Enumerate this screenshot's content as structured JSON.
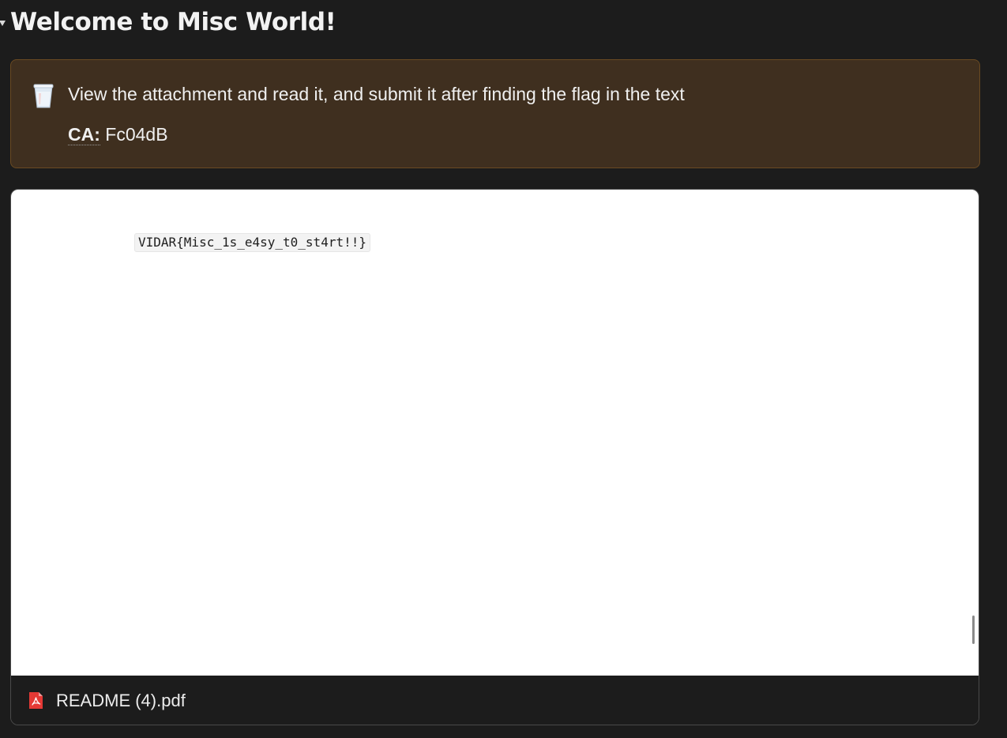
{
  "heading": {
    "title": "Welcome to Misc World!",
    "toggle_icon": "triangle-down-icon"
  },
  "callout": {
    "icon": "cup-icon",
    "text": "View the attachment and read it, and submit it after finding the flag in the text",
    "ca_label": "CA:",
    "ca_value": "Fc04dB",
    "colors": {
      "background": "#3f2f1f",
      "border": "#6a4a22"
    }
  },
  "attachment": {
    "flag_text": "VIDAR{Misc_1s_e4sy_t0_st4rt!!}",
    "file_icon": "pdf-icon",
    "file_name": "README (4).pdf",
    "colors": {
      "pdf_icon": "#e53935"
    }
  }
}
